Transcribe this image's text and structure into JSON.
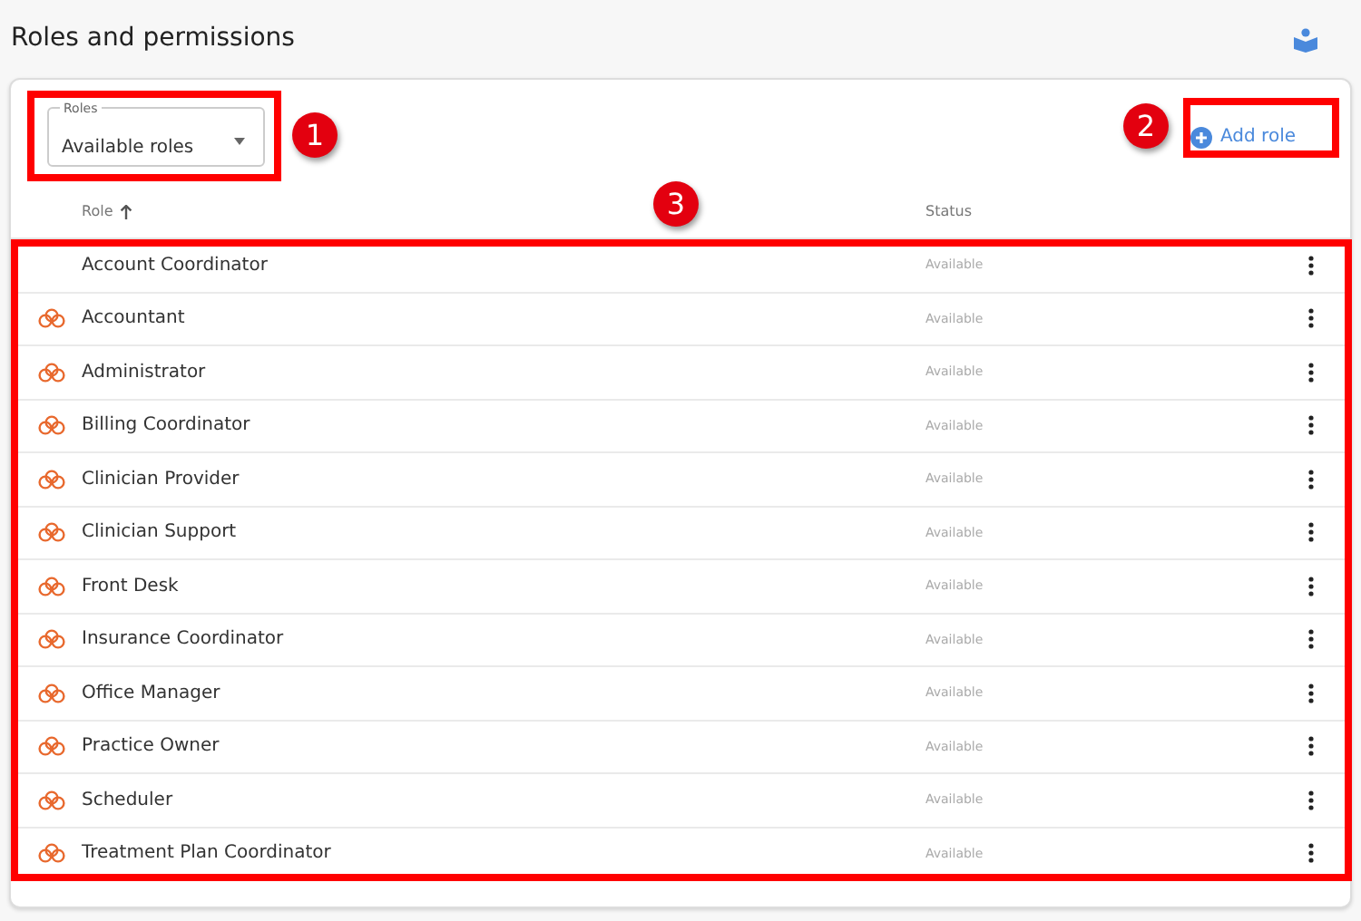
{
  "page": {
    "title": "Roles and permissions"
  },
  "filter": {
    "label": "Roles",
    "value": "Available roles"
  },
  "add_button": {
    "label": "Add role"
  },
  "table": {
    "columns": [
      {
        "label": "Role",
        "sorted_ascending": true
      },
      {
        "label": "Status"
      }
    ],
    "rows": [
      {
        "role": "Account Coordinator",
        "status": "Available",
        "has_icon": false
      },
      {
        "role": "Accountant",
        "status": "Available",
        "has_icon": true
      },
      {
        "role": "Administrator",
        "status": "Available",
        "has_icon": true
      },
      {
        "role": "Billing Coordinator",
        "status": "Available",
        "has_icon": true
      },
      {
        "role": "Clinician Provider",
        "status": "Available",
        "has_icon": true
      },
      {
        "role": "Clinician Support",
        "status": "Available",
        "has_icon": true
      },
      {
        "role": "Front Desk",
        "status": "Available",
        "has_icon": true
      },
      {
        "role": "Insurance Coordinator",
        "status": "Available",
        "has_icon": true
      },
      {
        "role": "Office Manager",
        "status": "Available",
        "has_icon": true
      },
      {
        "role": "Practice Owner",
        "status": "Available",
        "has_icon": true
      },
      {
        "role": "Scheduler",
        "status": "Available",
        "has_icon": true
      },
      {
        "role": "Treatment Plan Coordinator",
        "status": "Available",
        "has_icon": true
      }
    ]
  },
  "callouts": [
    {
      "number": "1"
    },
    {
      "number": "2"
    },
    {
      "number": "3"
    }
  ]
}
